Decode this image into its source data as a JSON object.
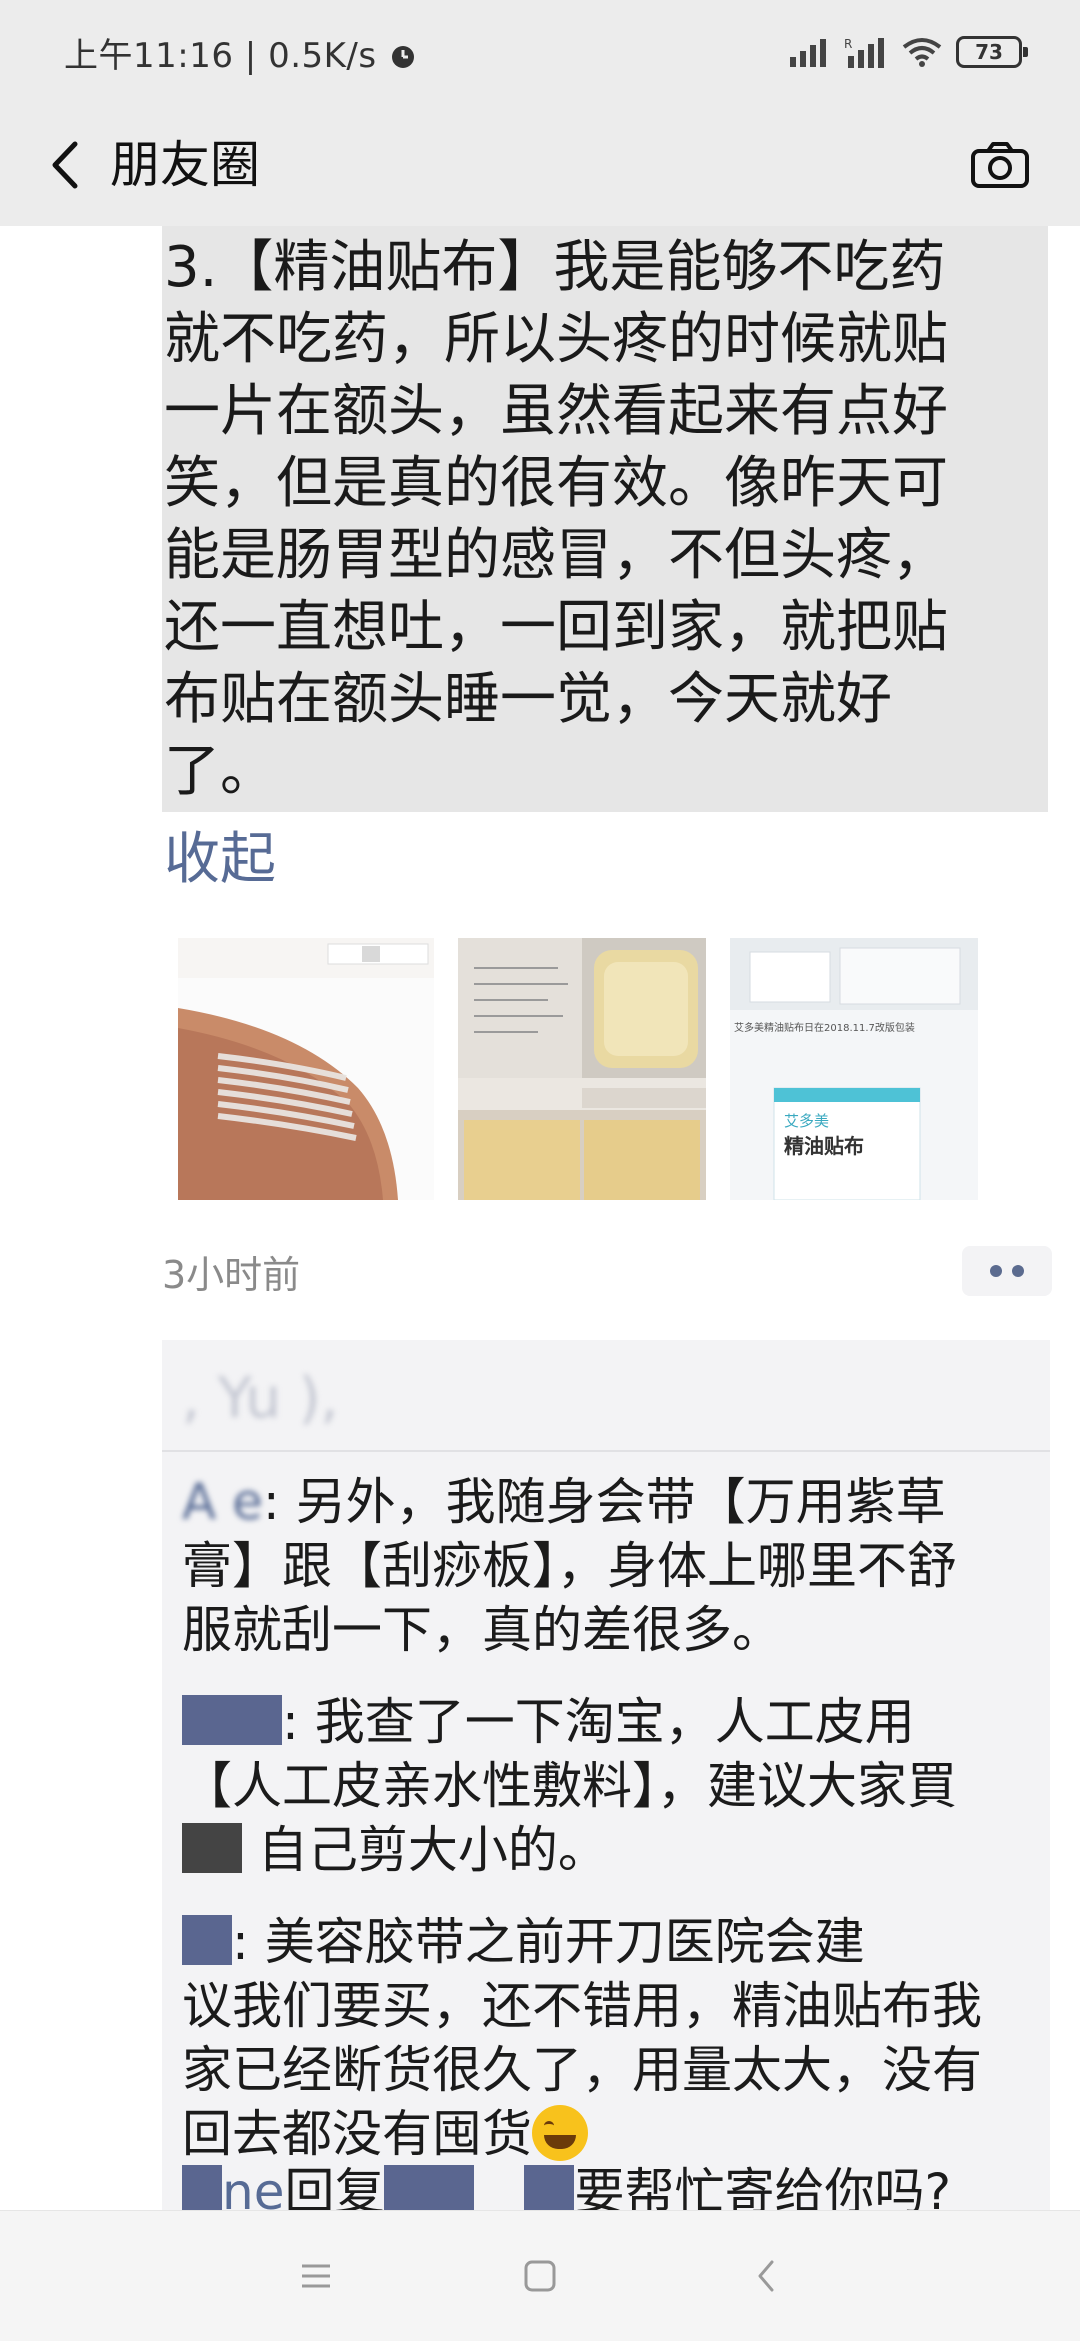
{
  "status_bar": {
    "time": "上午11:16",
    "speed": "0.5K/s",
    "battery": "73"
  },
  "header": {
    "title": "朋友圈"
  },
  "post": {
    "text_lines": [
      "3.【精油贴布】我是能够不吃药",
      "就不吃药，所以头疼的时候就贴",
      "一片在额头，虽然看起来有点好",
      "笑，但是真的很有效。像昨天可",
      "能是肠胃型的感冒，不但头疼，",
      "还一直想吐，一回到家，就把贴",
      "布贴在额头睡一觉，今天就好",
      "了。"
    ],
    "collapse_label": "收起",
    "photo3_caption": "艾多美精油贴布日在2018.11.7改版包装",
    "photo3_box_title": "精油贴布",
    "photo3_box_brand": "艾多美",
    "time": "3小时前"
  },
  "comments": {
    "likes": ", Yu     ),",
    "items": [
      {
        "name": "A   e",
        "text_line1": ": 另外，我随身会带【万用紫草",
        "text_line2": "膏】跟【刮痧板】，身体上哪里不舒",
        "text_line3": "服就刮一下，真的差很多。"
      },
      {
        "name": "",
        "text_line1": ": 我查了一下淘宝，人工皮用",
        "text_line2": "【人工皮亲水性敷料】，建议大家買",
        "text_line3": "自己剪大小的。"
      },
      {
        "name": "",
        "text_line1": ": 美容胶带之前开刀医院会建",
        "text_line2": "议我们要买，还不错用，精油贴布我",
        "text_line3": "家已经断货很久了，用量太大，没有",
        "text_line4": "回去都没有囤货"
      },
      {
        "name": "ne",
        "reply_label": "回复",
        "text_line1": "要帮忙寄给你吗?"
      }
    ]
  }
}
